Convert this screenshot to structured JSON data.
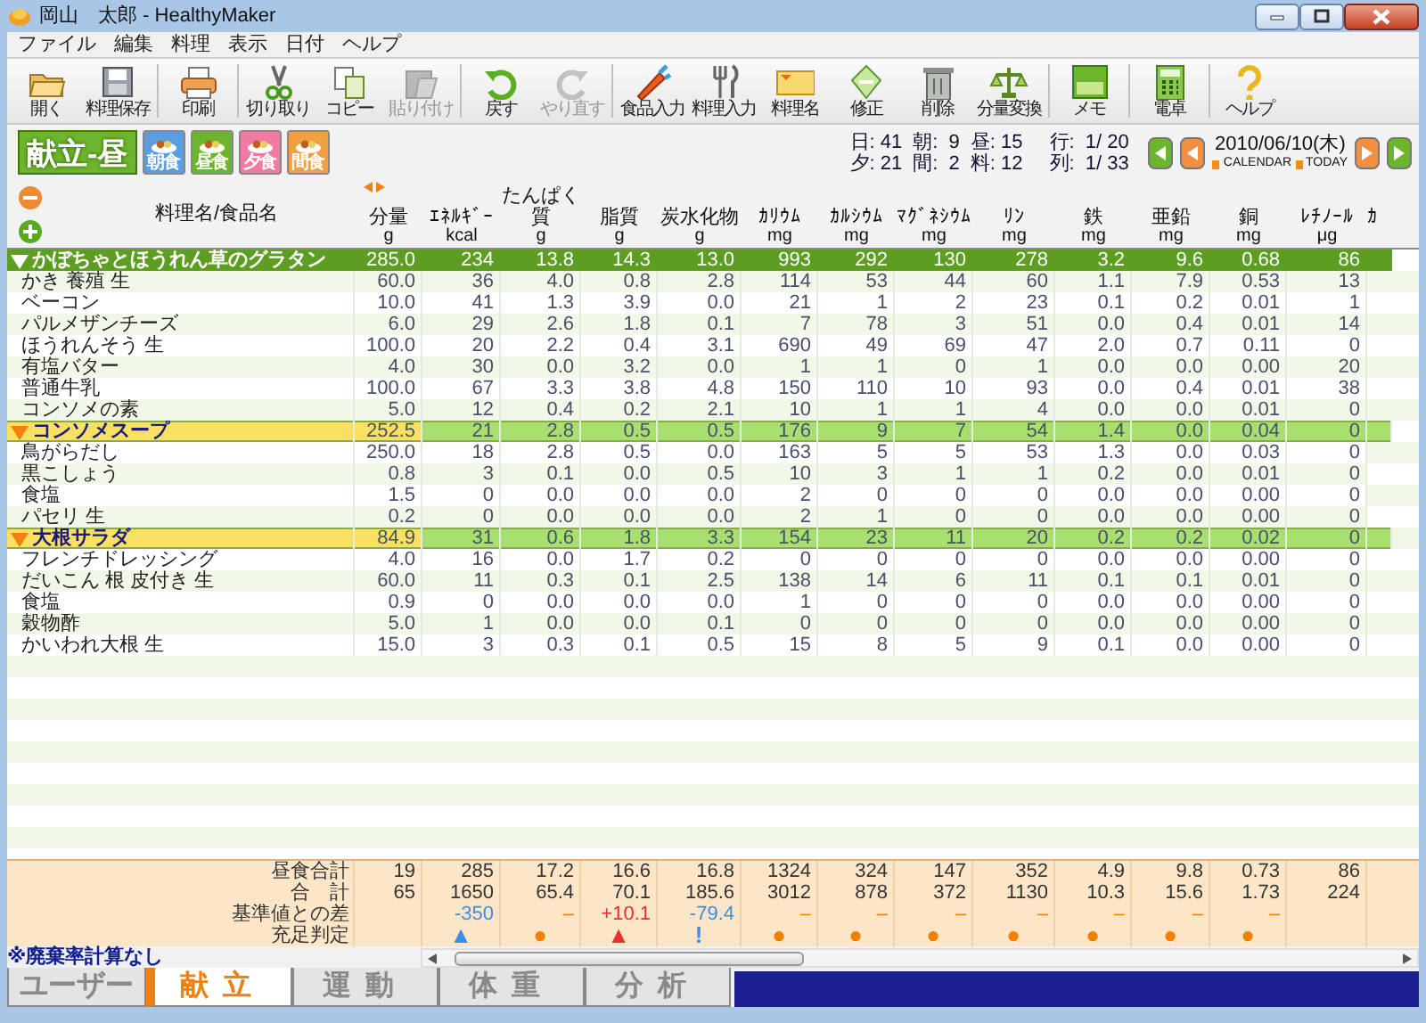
{
  "window": {
    "title": "岡山　太郎 - HealthyMaker"
  },
  "menu": [
    "ファイル",
    "編集",
    "料理",
    "表示",
    "日付",
    "ヘルプ"
  ],
  "toolbar": [
    {
      "label": "開く",
      "disabled": false
    },
    {
      "label": "料理保存",
      "disabled": false
    },
    {
      "label": "印刷",
      "disabled": false
    },
    {
      "label": "切り取り",
      "disabled": false
    },
    {
      "label": "コピー",
      "disabled": false
    },
    {
      "label": "貼り付け",
      "disabled": true
    },
    {
      "label": "戻す",
      "disabled": false
    },
    {
      "label": "やり直す",
      "disabled": true
    },
    {
      "label": "食品入力",
      "disabled": false
    },
    {
      "label": "料理入力",
      "disabled": false
    },
    {
      "label": "料理名",
      "disabled": false
    },
    {
      "label": "修正",
      "disabled": false
    },
    {
      "label": "削除",
      "disabled": false
    },
    {
      "label": "分量変換",
      "disabled": false
    },
    {
      "label": "メモ",
      "disabled": false
    },
    {
      "label": "電卓",
      "disabled": false
    },
    {
      "label": "ヘルプ",
      "disabled": false
    }
  ],
  "meal_header": {
    "title": "献立-昼",
    "meals": [
      {
        "label": "朝食",
        "color": "#5a9ee0"
      },
      {
        "label": "昼食",
        "color": "#6cb52c"
      },
      {
        "label": "夕食",
        "color": "#f07aa0"
      },
      {
        "label": "間食",
        "color": "#f0a040"
      }
    ],
    "stats": [
      "日: 41",
      "朝:  9",
      "昼: 15",
      "夕: 21",
      "間:  2",
      "料: 12"
    ],
    "position": [
      "行:  1/ 20",
      "列:  1/ 33"
    ],
    "date": "2010/06/10(木)",
    "links": [
      "CALENDAR",
      "TODAY"
    ]
  },
  "table": {
    "columns": [
      {
        "label": "料理名/食品名"
      },
      {
        "label": "分量",
        "unit": "g"
      },
      {
        "label": "ｴﾈﾙｷﾞｰ",
        "unit": "kcal"
      },
      {
        "label": "たんぱく質",
        "unit": "g"
      },
      {
        "label": "脂質",
        "unit": "g"
      },
      {
        "label": "炭水化物",
        "unit": "g"
      },
      {
        "label": "ｶﾘｳﾑ",
        "unit": "mg"
      },
      {
        "label": "ｶﾙｼｳﾑ",
        "unit": "mg"
      },
      {
        "label": "ﾏｸﾞﾈｼｳﾑ",
        "unit": "mg"
      },
      {
        "label": "ﾘﾝ",
        "unit": "mg"
      },
      {
        "label": "鉄",
        "unit": "mg"
      },
      {
        "label": "亜鉛",
        "unit": "mg"
      },
      {
        "label": "銅",
        "unit": "mg"
      },
      {
        "label": "ﾚﾁﾉｰﾙ",
        "unit": "μg"
      },
      {
        "label": "ｶ"
      }
    ],
    "rows": [
      {
        "kind": "dish",
        "name": "かぼちゃとほうれん草のグラタン",
        "expanded": true,
        "selected": true,
        "values": [
          "285.0",
          "234",
          "13.8",
          "14.3",
          "13.0",
          "993",
          "292",
          "130",
          "278",
          "3.2",
          "9.6",
          "0.68",
          "86"
        ]
      },
      {
        "kind": "food",
        "name": "かき 養殖 生",
        "values": [
          "60.0",
          "36",
          "4.0",
          "0.8",
          "2.8",
          "114",
          "53",
          "44",
          "60",
          "1.1",
          "7.9",
          "0.53",
          "13"
        ]
      },
      {
        "kind": "food",
        "name": "ベーコン",
        "values": [
          "10.0",
          "41",
          "1.3",
          "3.9",
          "0.0",
          "21",
          "1",
          "2",
          "23",
          "0.1",
          "0.2",
          "0.01",
          "1"
        ]
      },
      {
        "kind": "food",
        "name": "パルメザンチーズ",
        "values": [
          "6.0",
          "29",
          "2.6",
          "1.8",
          "0.1",
          "7",
          "78",
          "3",
          "51",
          "0.0",
          "0.4",
          "0.01",
          "14"
        ]
      },
      {
        "kind": "food",
        "name": "ほうれんそう 生",
        "values": [
          "100.0",
          "20",
          "2.2",
          "0.4",
          "3.1",
          "690",
          "49",
          "69",
          "47",
          "2.0",
          "0.7",
          "0.11",
          "0"
        ]
      },
      {
        "kind": "food",
        "name": "有塩バター",
        "values": [
          "4.0",
          "30",
          "0.0",
          "3.2",
          "0.0",
          "1",
          "1",
          "0",
          "1",
          "0.0",
          "0.0",
          "0.00",
          "20"
        ]
      },
      {
        "kind": "food",
        "name": "普通牛乳",
        "values": [
          "100.0",
          "67",
          "3.3",
          "3.8",
          "4.8",
          "150",
          "110",
          "10",
          "93",
          "0.0",
          "0.4",
          "0.01",
          "38"
        ]
      },
      {
        "kind": "food",
        "name": "コンソメの素",
        "values": [
          "5.0",
          "12",
          "0.4",
          "0.2",
          "2.1",
          "10",
          "1",
          "1",
          "4",
          "0.0",
          "0.0",
          "0.01",
          "0"
        ]
      },
      {
        "kind": "dish",
        "name": "コンソメスープ",
        "expanded": true,
        "selected": false,
        "values": [
          "252.5",
          "21",
          "2.8",
          "0.5",
          "0.5",
          "176",
          "9",
          "7",
          "54",
          "1.4",
          "0.0",
          "0.04",
          "0"
        ]
      },
      {
        "kind": "food",
        "name": "鳥がらだし",
        "values": [
          "250.0",
          "18",
          "2.8",
          "0.5",
          "0.0",
          "163",
          "5",
          "5",
          "53",
          "1.3",
          "0.0",
          "0.03",
          "0"
        ]
      },
      {
        "kind": "food",
        "name": "黒こしょう",
        "values": [
          "0.8",
          "3",
          "0.1",
          "0.0",
          "0.5",
          "10",
          "3",
          "1",
          "1",
          "0.2",
          "0.0",
          "0.01",
          "0"
        ]
      },
      {
        "kind": "food",
        "name": "食塩",
        "values": [
          "1.5",
          "0",
          "0.0",
          "0.0",
          "0.0",
          "2",
          "0",
          "0",
          "0",
          "0.0",
          "0.0",
          "0.00",
          "0"
        ]
      },
      {
        "kind": "food",
        "name": "パセリ 生",
        "values": [
          "0.2",
          "0",
          "0.0",
          "0.0",
          "0.0",
          "2",
          "1",
          "0",
          "0",
          "0.0",
          "0.0",
          "0.00",
          "0"
        ]
      },
      {
        "kind": "dish",
        "name": "大根サラダ",
        "expanded": true,
        "selected": false,
        "values": [
          "84.9",
          "31",
          "0.6",
          "1.8",
          "3.3",
          "154",
          "23",
          "11",
          "20",
          "0.2",
          "0.2",
          "0.02",
          "0"
        ]
      },
      {
        "kind": "food",
        "name": "フレンチドレッシング",
        "values": [
          "4.0",
          "16",
          "0.0",
          "1.7",
          "0.2",
          "0",
          "0",
          "0",
          "0",
          "0.0",
          "0.0",
          "0.00",
          "0"
        ]
      },
      {
        "kind": "food",
        "name": "だいこん 根 皮付き 生",
        "values": [
          "60.0",
          "11",
          "0.3",
          "0.1",
          "2.5",
          "138",
          "14",
          "6",
          "11",
          "0.1",
          "0.1",
          "0.01",
          "0"
        ]
      },
      {
        "kind": "food",
        "name": "食塩",
        "values": [
          "0.9",
          "0",
          "0.0",
          "0.0",
          "0.0",
          "1",
          "0",
          "0",
          "0",
          "0.0",
          "0.0",
          "0.00",
          "0"
        ]
      },
      {
        "kind": "food",
        "name": "穀物酢",
        "values": [
          "5.0",
          "1",
          "0.0",
          "0.0",
          "0.1",
          "0",
          "0",
          "0",
          "0",
          "0.0",
          "0.0",
          "0.00",
          "0"
        ]
      },
      {
        "kind": "food",
        "name": "かいわれ大根 生",
        "values": [
          "15.0",
          "3",
          "0.3",
          "0.1",
          "0.5",
          "15",
          "8",
          "5",
          "9",
          "0.1",
          "0.0",
          "0.00",
          "0"
        ]
      }
    ]
  },
  "summary": [
    {
      "kind": "values",
      "label": "昼食合計",
      "values": [
        "19",
        "285",
        "17.2",
        "16.6",
        "16.8",
        "1324",
        "324",
        "147",
        "352",
        "4.9",
        "9.8",
        "0.73",
        "86"
      ]
    },
    {
      "kind": "values",
      "label": "合　計",
      "values": [
        "65",
        "1650",
        "65.4",
        "70.1",
        "185.6",
        "3012",
        "878",
        "372",
        "1130",
        "10.3",
        "15.6",
        "1.73",
        "224"
      ]
    },
    {
      "kind": "diff",
      "label": "基準値との差",
      "cells": [
        {
          "kind": "none"
        },
        {
          "kind": "under",
          "text": "-350"
        },
        {
          "kind": "ok",
          "text": "–"
        },
        {
          "kind": "over",
          "text": "+10.1"
        },
        {
          "kind": "under",
          "text": "-79.4"
        },
        {
          "kind": "ok",
          "text": "–"
        },
        {
          "kind": "ok",
          "text": "–"
        },
        {
          "kind": "ok",
          "text": "–"
        },
        {
          "kind": "ok",
          "text": "–"
        },
        {
          "kind": "ok",
          "text": "–"
        },
        {
          "kind": "ok",
          "text": "–"
        },
        {
          "kind": "ok",
          "text": "–"
        },
        {
          "kind": "none"
        }
      ]
    },
    {
      "kind": "judge",
      "label": "充足判定",
      "cells": [
        {
          "kind": "none"
        },
        {
          "kind": "under",
          "text": "▲"
        },
        {
          "kind": "ok",
          "text": "●"
        },
        {
          "kind": "over",
          "text": "▲"
        },
        {
          "kind": "warn",
          "text": "!"
        },
        {
          "kind": "ok",
          "text": "●"
        },
        {
          "kind": "ok",
          "text": "●"
        },
        {
          "kind": "ok",
          "text": "●"
        },
        {
          "kind": "ok",
          "text": "●"
        },
        {
          "kind": "ok",
          "text": "●"
        },
        {
          "kind": "ok",
          "text": "●"
        },
        {
          "kind": "ok",
          "text": "●"
        },
        {
          "kind": "none"
        }
      ]
    }
  ],
  "note": "※廃棄率計算なし",
  "tabs": [
    {
      "label": "ユーザー",
      "selected": false
    },
    {
      "label": "献立",
      "selected": true
    },
    {
      "label": "運動",
      "selected": false
    },
    {
      "label": "体重",
      "selected": false
    },
    {
      "label": "分析",
      "selected": false
    }
  ]
}
